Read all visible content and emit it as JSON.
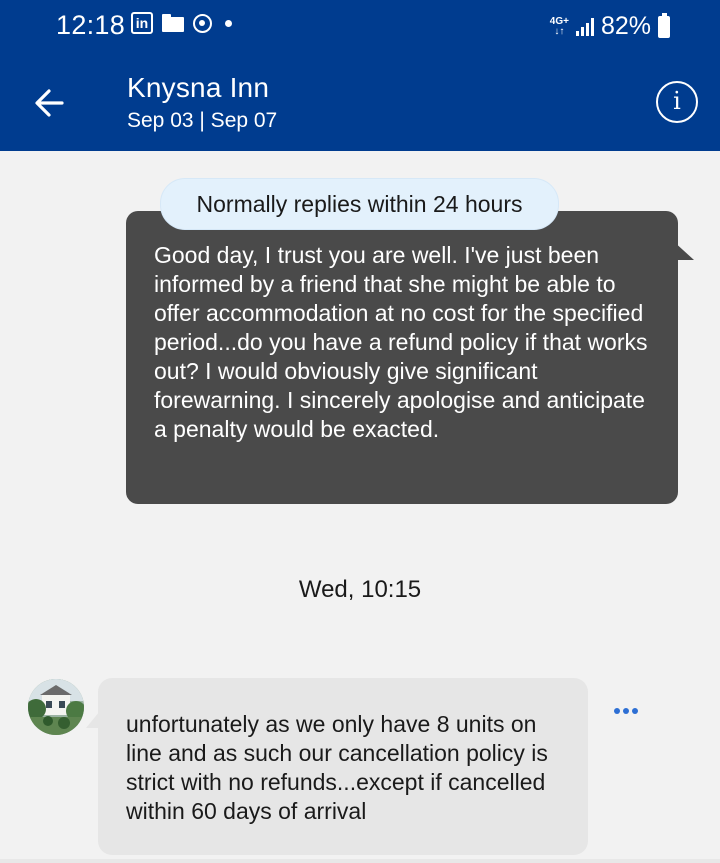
{
  "status_bar": {
    "time": "12:18",
    "network": "4G+",
    "battery": "82%",
    "icons": [
      "linkedin-icon",
      "folder-icon",
      "sync-circle-icon",
      "notification-dot-icon",
      "signal-icon",
      "battery-icon"
    ]
  },
  "header": {
    "title": "Knysna Inn",
    "dates": "Sep 03 | Sep 07",
    "background_color": "#003c8f",
    "back_icon": "arrow-left-icon",
    "info_icon": "info-icon",
    "info_glyph": "i"
  },
  "conversation": {
    "notice": "Normally replies within 24 hours",
    "outgoing_message": "Good day, I trust you are well. I've just been informed by a friend that she might be able to offer accommodation at no cost for the specified period...do you have a refund policy if that works out? I would obviously give significant forewarning. I sincerely apologise and anticipate a penalty would be exacted.",
    "day_separator": "Wed, 10:15",
    "incoming_message": "unfortunately as we only have 8 units on line and as such our cancellation policy is strict with no refunds...except if cancelled within 60 days of arrival",
    "incoming_bubble_color": "#e6e6e6",
    "outgoing_bubble_color": "#4a4a4a",
    "more_icon": "more-dots-icon"
  }
}
